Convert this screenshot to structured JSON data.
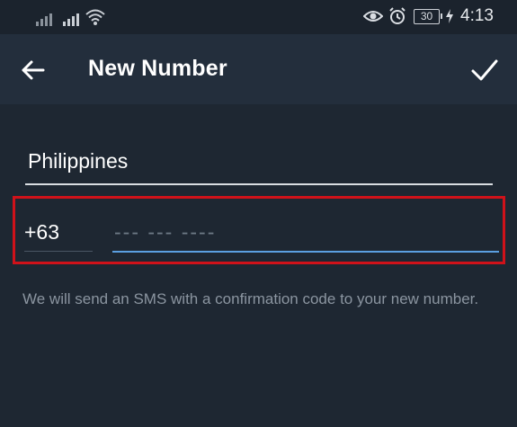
{
  "status_bar": {
    "time": "4:13",
    "battery": "30",
    "icons": [
      "signal-icon",
      "signal-icon",
      "wifi-icon",
      "eye-icon",
      "alarm-icon",
      "battery-icon",
      "charging-icon"
    ]
  },
  "header": {
    "title": "New Number",
    "back_icon": "arrow-left-icon",
    "done_icon": "checkmark-icon"
  },
  "form": {
    "country": "Philippines",
    "country_code": "+63",
    "phone_placeholder": "--- --- ----",
    "highlight_color": "#d0121a",
    "accent_color": "#5b9fe0"
  },
  "info": {
    "text": "We will send an SMS with a confirmation code to your new number."
  }
}
